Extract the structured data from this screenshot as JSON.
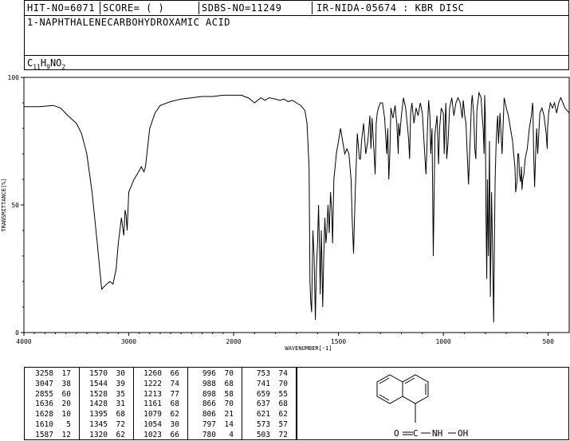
{
  "header": {
    "hit_no": "HIT-NO=6071",
    "score": "SCORE=  (   )",
    "sdbs_no": "SDBS-NO=11249",
    "ir_id": "IR-NIDA-05674 : KBR DISC"
  },
  "compound_name": "1-NAPHTHALENECARBOHYDROXAMIC ACID",
  "formula": {
    "C": "C",
    "c_n": "11",
    "H": "H",
    "h_n": "9",
    "rest": "NO",
    "o_n": "2"
  },
  "chart_data": {
    "type": "line",
    "xlabel": "WAVENUMBER[-1]",
    "ylabel": "TRANSMITTANCE[%]",
    "xlim": [
      4000,
      400
    ],
    "ylim": [
      0,
      100
    ],
    "x_ticks": [
      "4000",
      "3000",
      "2000",
      "1500",
      "1000",
      "500"
    ],
    "y_ticks": [
      "100",
      "50",
      "0"
    ],
    "series": [
      {
        "x": [
          4000,
          3850,
          3720,
          3650,
          3580,
          3500,
          3450,
          3400,
          3350,
          3300,
          3270,
          3258,
          3235,
          3210,
          3180,
          3150,
          3120,
          3100,
          3070,
          3047,
          3035,
          3025,
          3015,
          3000,
          2980,
          2950,
          2920,
          2880,
          2855,
          2840,
          2800,
          2750,
          2700,
          2600,
          2500,
          2400,
          2300,
          2200,
          2100,
          2000,
          1960,
          1950,
          1930,
          1900,
          1870,
          1850,
          1830,
          1800,
          1780,
          1760,
          1740,
          1720,
          1700,
          1680,
          1660,
          1650,
          1640,
          1636,
          1632,
          1628,
          1622,
          1616,
          1610,
          1605,
          1600,
          1595,
          1590,
          1587,
          1582,
          1578,
          1575,
          1570,
          1565,
          1560,
          1555,
          1550,
          1544,
          1538,
          1532,
          1528,
          1522,
          1516,
          1510,
          1500,
          1490,
          1480,
          1470,
          1460,
          1450,
          1440,
          1435,
          1428,
          1420,
          1410,
          1400,
          1395,
          1390,
          1380,
          1370,
          1360,
          1350,
          1345,
          1340,
          1330,
          1325,
          1320,
          1315,
          1310,
          1300,
          1290,
          1280,
          1270,
          1265,
          1260,
          1255,
          1250,
          1240,
          1230,
          1222,
          1215,
          1213,
          1208,
          1200,
          1190,
          1180,
          1170,
          1165,
          1161,
          1156,
          1150,
          1140,
          1130,
          1120,
          1110,
          1100,
          1090,
          1083,
          1079,
          1075,
          1070,
          1064,
          1060,
          1054,
          1048,
          1040,
          1030,
          1023,
          1018,
          1010,
          1000,
          996,
          992,
          988,
          984,
          978,
          970,
          960,
          950,
          940,
          930,
          920,
          910,
          905,
          898,
          892,
          880,
          870,
          866,
          862,
          855,
          850,
          845,
          840,
          830,
          820,
          815,
          810,
          806,
          803,
          800,
          797,
          793,
          790,
          785,
          780,
          776,
          770,
          765,
          760,
          756,
          753,
          748,
          745,
          741,
          737,
          730,
          720,
          710,
          700,
          690,
          680,
          670,
          665,
          659,
          655,
          648,
          645,
          641,
          637,
          632,
          628,
          625,
          621,
          616,
          610,
          600,
          590,
          580,
          575,
          573,
          570,
          565,
          560,
          555,
          550,
          540,
          530,
          520,
          510,
          505,
          503,
          498,
          490,
          480,
          470,
          460,
          450,
          440,
          430,
          420,
          410,
          400
        ],
        "y": [
          88.5,
          88.5,
          89,
          88,
          85,
          82,
          78,
          70,
          55,
          35,
          22,
          17,
          18,
          19,
          20,
          19,
          25,
          35,
          45,
          38,
          48,
          46,
          40,
          55,
          57,
          60,
          62,
          65,
          63,
          65,
          80,
          86,
          89,
          90.5,
          91.5,
          92,
          92.5,
          92.5,
          93,
          93,
          93,
          92.5,
          92,
          90,
          92,
          91,
          92,
          91.5,
          91,
          91.5,
          90.5,
          91,
          90,
          89,
          87,
          82,
          65,
          20,
          12,
          8,
          40,
          30,
          5,
          25,
          35,
          50,
          30,
          15,
          40,
          25,
          10,
          30,
          45,
          35,
          40,
          50,
          39,
          55,
          48,
          35,
          60,
          65,
          70,
          75,
          80,
          75,
          70,
          72,
          70,
          60,
          45,
          31,
          55,
          78,
          68,
          68,
          75,
          82,
          70,
          75,
          85,
          72,
          84,
          70,
          62,
          82,
          86,
          88,
          90,
          90,
          84,
          70,
          80,
          60,
          70,
          88,
          84,
          89,
          82,
          70,
          82,
          77,
          85,
          92,
          88,
          80,
          75,
          68,
          86,
          90,
          82,
          88,
          85,
          90,
          86,
          72,
          62,
          70,
          82,
          91,
          85,
          70,
          80,
          30,
          78,
          85,
          66,
          80,
          88,
          86,
          70,
          82,
          90,
          68,
          74,
          88,
          92,
          85,
          90,
          92,
          90,
          84,
          91,
          85,
          82,
          58,
          80,
          90,
          93,
          85,
          72,
          68,
          87,
          94,
          92,
          85,
          80,
          70,
          93,
          85,
          50,
          21,
          60,
          30,
          75,
          14,
          55,
          30,
          4,
          40,
          60,
          75,
          80,
          85,
          74,
          86,
          70,
          92,
          88,
          85,
          80,
          75,
          70,
          65,
          55,
          60,
          70,
          70,
          62,
          59,
          65,
          56,
          60,
          62,
          68,
          72,
          80,
          85,
          90,
          88,
          72,
          57,
          70,
          80,
          70,
          86,
          88,
          85,
          78,
          72,
          80,
          86,
          90,
          88,
          90,
          86,
          90,
          92,
          90,
          88,
          87,
          86
        ]
      }
    ]
  },
  "peak_table": {
    "columns": [
      [
        [
          "3258",
          "17"
        ],
        [
          "3047",
          "38"
        ],
        [
          "2855",
          "60"
        ],
        [
          "1636",
          "20"
        ],
        [
          "1628",
          "10"
        ],
        [
          "1610",
          "5"
        ],
        [
          "1587",
          "12"
        ]
      ],
      [
        [
          "1570",
          "30"
        ],
        [
          "1544",
          "39"
        ],
        [
          "1528",
          "35"
        ],
        [
          "1428",
          "31"
        ],
        [
          "1395",
          "68"
        ],
        [
          "1345",
          "72"
        ],
        [
          "1320",
          "62"
        ]
      ],
      [
        [
          "1260",
          "66"
        ],
        [
          "1222",
          "74"
        ],
        [
          "1213",
          "77"
        ],
        [
          "1161",
          "68"
        ],
        [
          "1079",
          "62"
        ],
        [
          "1054",
          "30"
        ],
        [
          "1023",
          "66"
        ]
      ],
      [
        [
          "996",
          "70"
        ],
        [
          "988",
          "68"
        ],
        [
          "898",
          "58"
        ],
        [
          "866",
          "70"
        ],
        [
          "806",
          "21"
        ],
        [
          "797",
          "14"
        ],
        [
          "780",
          "4"
        ]
      ],
      [
        [
          "753",
          "74"
        ],
        [
          "741",
          "70"
        ],
        [
          "659",
          "55"
        ],
        [
          "637",
          "68"
        ],
        [
          "621",
          "62"
        ],
        [
          "573",
          "57"
        ],
        [
          "503",
          "72"
        ]
      ]
    ]
  },
  "structure": {
    "substituent_label": "O=C-NH-OH",
    "c_label": "C",
    "o_label": "O",
    "nh_label": "NH",
    "oh_label": "OH"
  }
}
